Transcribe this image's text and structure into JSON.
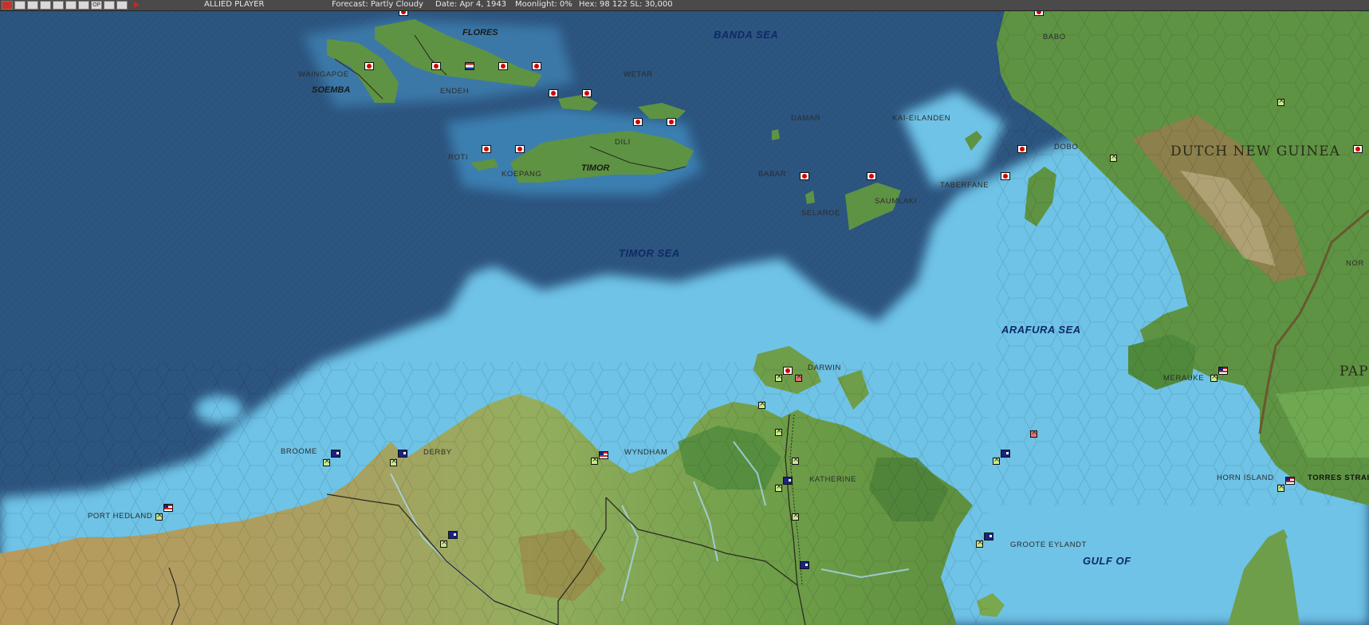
{
  "toolbar": {
    "buttons": [
      {
        "icon": "flag-icon"
      },
      {
        "icon": "ship-icon"
      },
      {
        "icon": "aircraft-icon"
      },
      {
        "icon": "base-icon"
      },
      {
        "icon": "unit-icon"
      },
      {
        "icon": "globe-icon"
      },
      {
        "icon": "intel-icon"
      },
      {
        "label": "OP"
      },
      {
        "icon": "report-icon"
      },
      {
        "icon": "save-icon"
      }
    ],
    "side": "ALLIED PLAYER",
    "forecast": "Forecast: Partly Cloudy",
    "date": "Date: Apr 4, 1943",
    "moonlight": "Moonlight: 0%",
    "hex": "Hex: 98 122  SL: 30,000"
  },
  "map": {
    "seas": [
      {
        "name": "BANDA SEA"
      },
      {
        "name": "TIMOR SEA"
      },
      {
        "name": "ARAFURA SEA"
      },
      {
        "name": "GULF OF"
      }
    ],
    "islands": [
      {
        "name": "FLORES"
      },
      {
        "name": "SOEMBA"
      },
      {
        "name": "TIMOR"
      }
    ],
    "regions": [
      {
        "name": "DUTCH NEW GUINEA"
      },
      {
        "name": "PAPUA"
      }
    ],
    "towns": [
      {
        "name": "WAINGAPOE"
      },
      {
        "name": "ENDEH"
      },
      {
        "name": "WETAR"
      },
      {
        "name": "DILI"
      },
      {
        "name": "ROTI"
      },
      {
        "name": "KOEPANG"
      },
      {
        "name": "DAMAR"
      },
      {
        "name": "KAI-EILANDEN"
      },
      {
        "name": "BABO"
      },
      {
        "name": "DOBO"
      },
      {
        "name": "BABAR"
      },
      {
        "name": "SAUMLAKI"
      },
      {
        "name": "TABERFANE"
      },
      {
        "name": "SELAROE"
      },
      {
        "name": "NOR"
      },
      {
        "name": "DARWIN"
      },
      {
        "name": "MERAUKE"
      },
      {
        "name": "BROOME"
      },
      {
        "name": "DERBY"
      },
      {
        "name": "WYNDHAM"
      },
      {
        "name": "KATHERINE"
      },
      {
        "name": "HORN ISLAND"
      },
      {
        "name": "TORRES STRAI"
      },
      {
        "name": "PORT HEDLAND"
      },
      {
        "name": "GROOTE EYLANDT"
      }
    ],
    "colors": {
      "deep_sea": "#2a4f78",
      "shallow_sea": "#6ec3e6",
      "land_green": "#6f9e4a",
      "land_desert": "#b99b5e",
      "japanese": "#d50000",
      "australian": "#1a237e"
    }
  }
}
